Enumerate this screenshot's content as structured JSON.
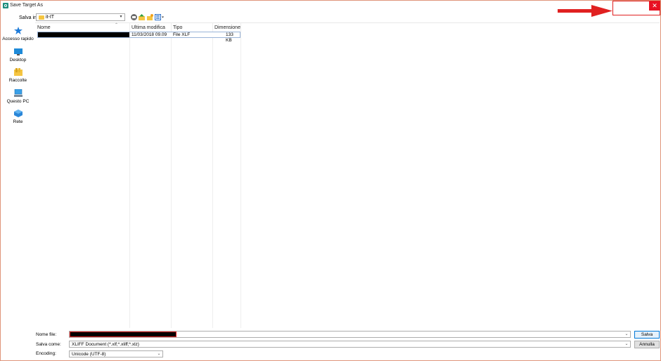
{
  "window": {
    "title": "Save Target As",
    "close_symbol": "✕"
  },
  "toolbar": {
    "save_in_label": "Salva in:",
    "save_in_value": "it-IT",
    "icons": [
      "back-icon",
      "up-folder-icon",
      "new-folder-icon",
      "view-menu-icon"
    ]
  },
  "nav": {
    "items": [
      {
        "label": "Accesso rapido",
        "icon": "star-icon"
      },
      {
        "label": "Desktop",
        "icon": "desktop-icon"
      },
      {
        "label": "Raccolte",
        "icon": "libraries-icon"
      },
      {
        "label": "Questo PC",
        "icon": "computer-icon"
      },
      {
        "label": "Rete",
        "icon": "network-icon"
      }
    ]
  },
  "filelist": {
    "columns": [
      "Nome",
      "Ultima modifica",
      "Tipo",
      "Dimensione"
    ],
    "rows": [
      {
        "name": "",
        "modified": "11/03/2018 09.09",
        "type": "File XLF",
        "size": "133 KB"
      }
    ]
  },
  "form": {
    "filename_label": "Nome file:",
    "filename_value": "",
    "savetype_label": "Salva come:",
    "savetype_value": "XLIFF Document (*.xlf;*.xliff;*.xlz)",
    "encoding_label": "Encoding:",
    "encoding_value": "Unicode (UTF-8)",
    "save_button": "Salva",
    "cancel_button": "Annulla"
  },
  "colors": {
    "annotation": "#e02020",
    "close": "#e81123",
    "accent": "#0078d7"
  }
}
